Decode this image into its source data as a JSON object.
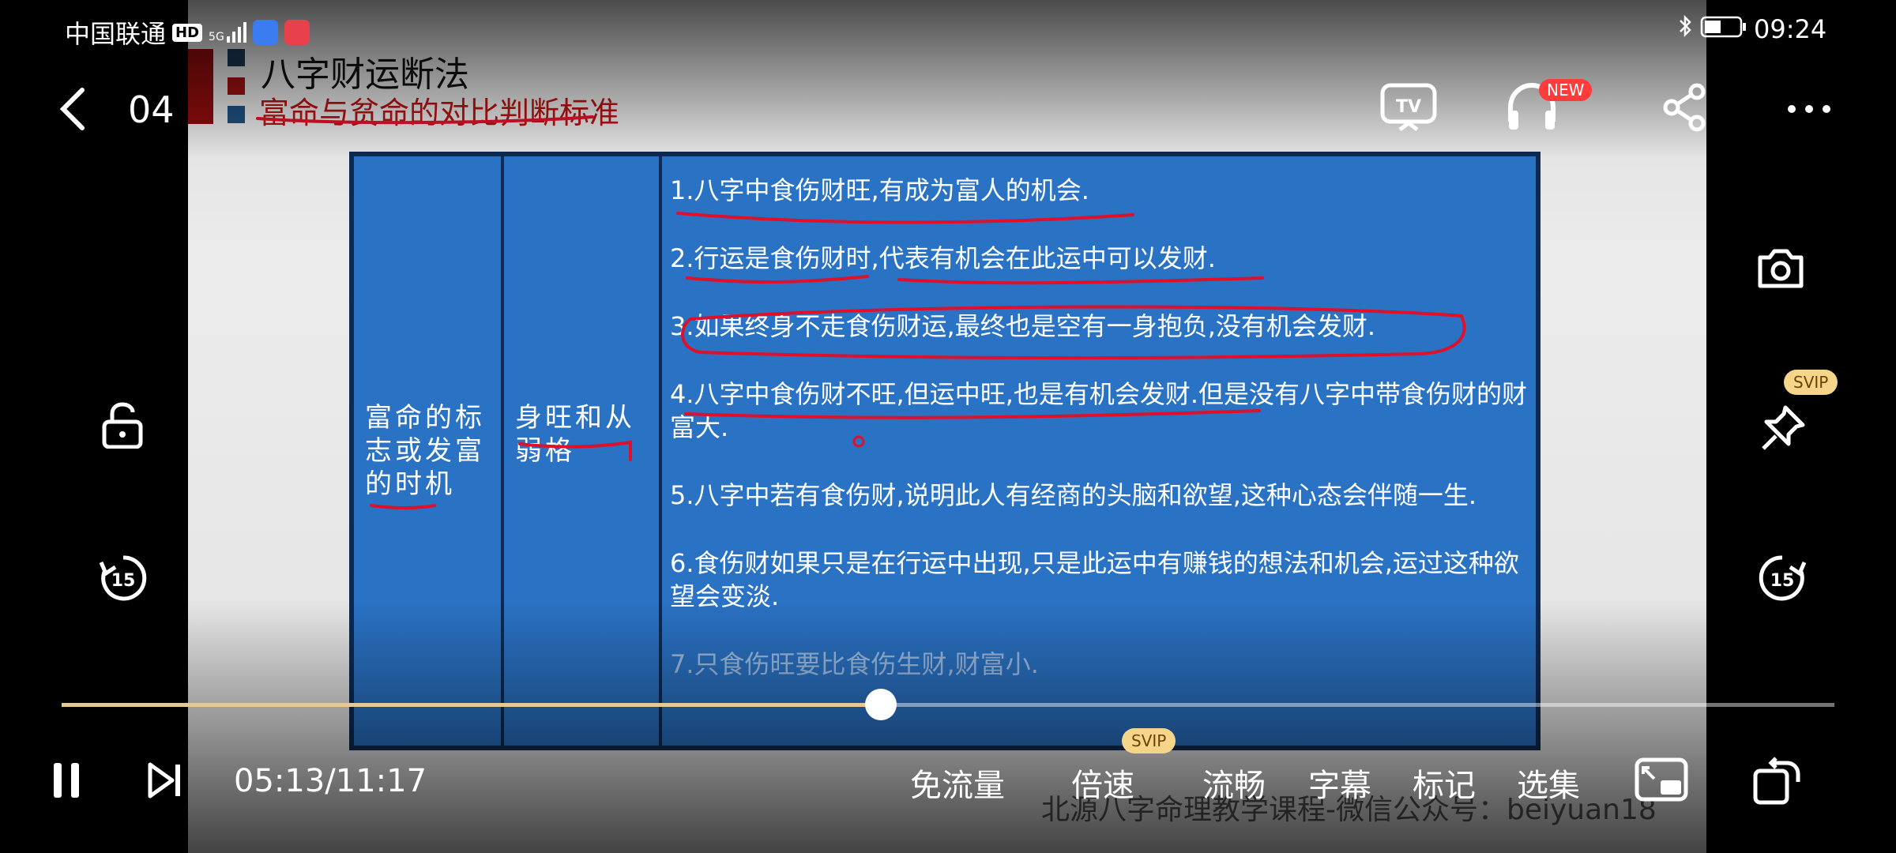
{
  "status_bar": {
    "carrier": "中国联通",
    "hd": "HD",
    "signal": "5G",
    "time": "09:24"
  },
  "player": {
    "episode": "04",
    "current_time": "05:13",
    "duration": "11:17",
    "time_display": "05:13/11:17",
    "progress": 0.462,
    "new_badge": "NEW",
    "svip_badge": "SVIP",
    "bottom_menu": [
      "免流量",
      "倍速",
      "流畅",
      "字幕",
      "标记",
      "选集"
    ]
  },
  "slide": {
    "title": "八字财运断法",
    "subtitle": "富命与贫命的对比判断标准",
    "col1": "富命的标志或发富的时机",
    "col2": "身旺和从弱格",
    "items": [
      "1.八字中食伤财旺,有成为富人的机会.",
      "2.行运是食伤财时,代表有机会在此运中可以发财.",
      "3.如果终身不走食伤财运,最终也是空有一身抱负,没有机会发财.",
      "4.八字中食伤财不旺,但运中旺,也是有机会发财.但是没有八字中带食伤财的财富大.",
      "5.八字中若有食伤财,说明此人有经商的头脑和欲望,这种心态会伴随一生.",
      "6.食伤财如果只是在行运中出现,只是此运中有赚钱的想法和机会,运过这种欲望会变淡.",
      "7.只食伤旺要比食伤生财,财富小."
    ],
    "watermark": "北源八字命理教学课程-微信公众号：beiyuan18"
  },
  "colors": {
    "panel": "#2a72c4",
    "progress": "#e4c998",
    "annotation": "#e0102a"
  }
}
